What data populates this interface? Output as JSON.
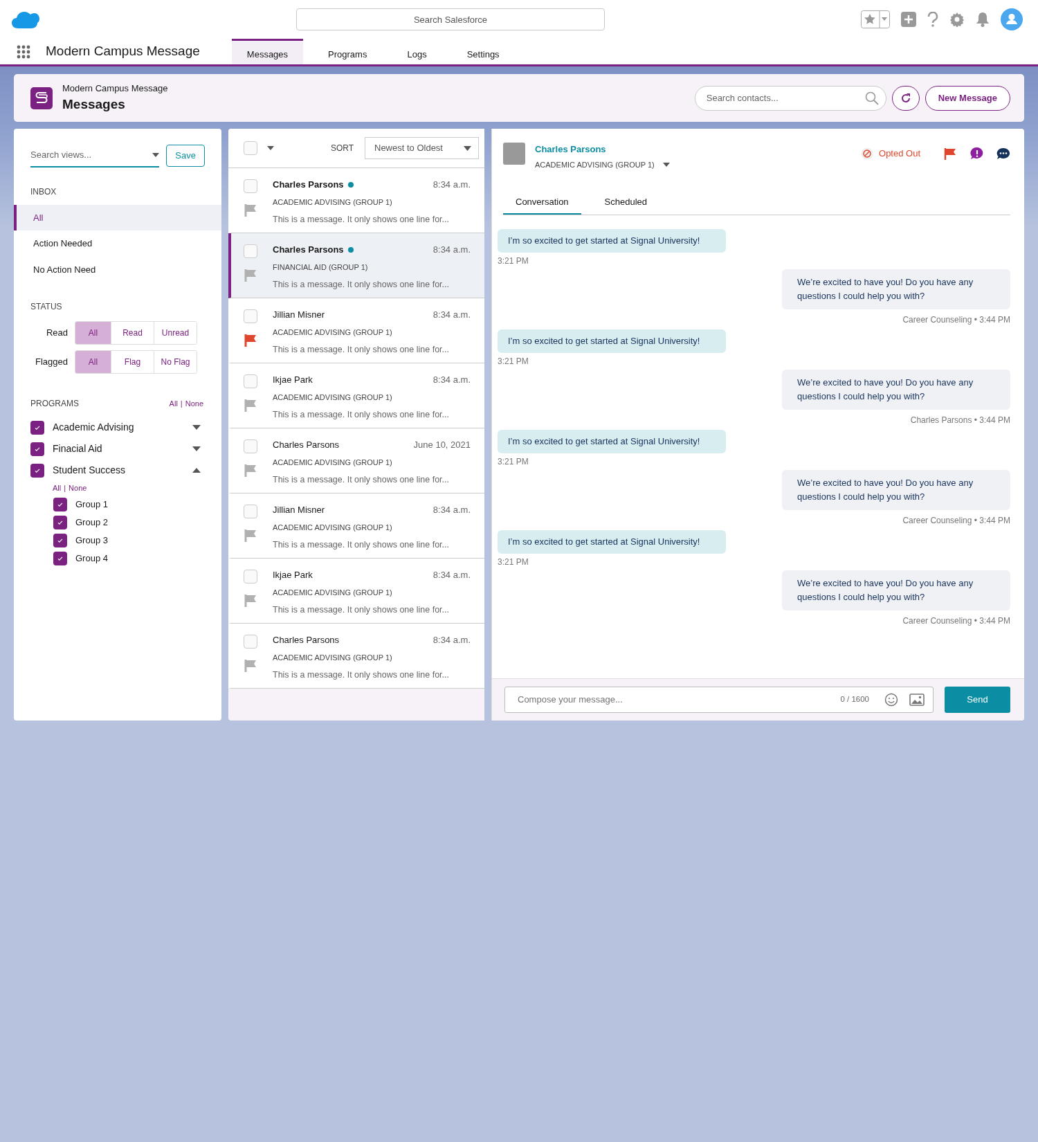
{
  "top_bar": {
    "search_placeholder": "Search Salesforce"
  },
  "app": {
    "name": "Modern Campus Message",
    "tabs": [
      {
        "label": "Messages",
        "selected": true
      },
      {
        "label": "Programs",
        "selected": false
      },
      {
        "label": "Logs",
        "selected": false
      },
      {
        "label": "Settings",
        "selected": false
      }
    ]
  },
  "page_header": {
    "app_name": "Modern Campus Message",
    "title": "Messages",
    "search_placeholder": "Search contacts...",
    "new_button": "New Message"
  },
  "sidebar": {
    "search_placeholder": "Search views...",
    "save_button": "Save",
    "inbox_heading": "INBOX",
    "inbox_items": [
      {
        "label": "All",
        "selected": true
      },
      {
        "label": "Action Needed",
        "selected": false
      },
      {
        "label": "No Action Need",
        "selected": false
      }
    ],
    "status_heading": "STATUS",
    "status_filters": [
      {
        "label": "Read",
        "options": [
          {
            "label": "All",
            "selected": true
          },
          {
            "label": "Read",
            "selected": false
          },
          {
            "label": "Unread",
            "selected": false
          }
        ]
      },
      {
        "label": "Flagged",
        "options": [
          {
            "label": "All",
            "selected": true
          },
          {
            "label": "Flag",
            "selected": false
          },
          {
            "label": "No Flag",
            "selected": false
          }
        ]
      }
    ],
    "programs_heading": "PROGRAMS",
    "programs_links": {
      "all": "All",
      "separator": "|",
      "none": "None"
    },
    "programs": [
      {
        "label": "Academic Advising",
        "checked": true,
        "expanded": false
      },
      {
        "label": "Finacial Aid",
        "checked": true,
        "expanded": false
      },
      {
        "label": "Student Success",
        "checked": true,
        "expanded": true,
        "links": {
          "all": "All",
          "separator": "|",
          "none": "None"
        },
        "children": [
          {
            "label": "Group 1",
            "checked": true
          },
          {
            "label": "Group 2",
            "checked": true
          },
          {
            "label": "Group 3",
            "checked": true
          },
          {
            "label": "Group 4",
            "checked": true
          }
        ]
      }
    ]
  },
  "message_list": {
    "select_all_checked": false,
    "sort_label": "SORT",
    "sort_value": "Newest to Oldest",
    "rows": [
      {
        "name": "Charles Parsons",
        "unread": true,
        "time": "8:34 a.m.",
        "program": "ACADEMIC ADVISING (GROUP 1)",
        "preview": "This is a message. It only shows one line for...",
        "checked": false,
        "flagged": false,
        "selected": false
      },
      {
        "name": "Charles Parsons",
        "unread": true,
        "time": "8:34 a.m.",
        "program": "FINANCIAL AID (GROUP 1)",
        "preview": "This is a message. It only shows one line for...",
        "checked": false,
        "flagged": false,
        "selected": true
      },
      {
        "name": "Jillian Misner",
        "unread": false,
        "time": "8:34 a.m.",
        "program": "ACADEMIC ADVISING (GROUP 1)",
        "preview": "This is a message. It only shows one line for...",
        "checked": false,
        "flagged": true,
        "selected": false
      },
      {
        "name": "Ikjae Park",
        "unread": false,
        "time": "8:34 a.m.",
        "program": "ACADEMIC ADVISING (GROUP 1)",
        "preview": "This is a message. It only shows one line for...",
        "checked": false,
        "flagged": false,
        "selected": false
      },
      {
        "name": "Charles Parsons",
        "unread": false,
        "time": "June 10, 2021",
        "program": "ACADEMIC ADVISING (GROUP 1)",
        "preview": "This is a message. It only shows one line for...",
        "checked": false,
        "flagged": false,
        "selected": false
      },
      {
        "name": "Jillian Misner",
        "unread": false,
        "time": "8:34 a.m.",
        "program": "ACADEMIC ADVISING (GROUP 1)",
        "preview": "This is a message. It only shows one line for...",
        "checked": false,
        "flagged": false,
        "selected": false
      },
      {
        "name": "Ikjae Park",
        "unread": false,
        "time": "8:34 a.m.",
        "program": "ACADEMIC ADVISING (GROUP 1)",
        "preview": "This is a message. It only shows one line for...",
        "checked": false,
        "flagged": false,
        "selected": false
      },
      {
        "name": "Charles Parsons",
        "unread": false,
        "time": "8:34 a.m.",
        "program": "ACADEMIC ADVISING (GROUP 1)",
        "preview": "This is a message. It only shows one line for...",
        "checked": false,
        "flagged": false,
        "selected": false
      }
    ]
  },
  "conversation": {
    "contact": {
      "name": "Charles Parsons",
      "program": "ACADEMIC ADVISING (GROUP 1)"
    },
    "status": "Opted Out",
    "tabs": [
      {
        "label": "Conversation",
        "selected": true
      },
      {
        "label": "Scheduled",
        "selected": false
      }
    ],
    "messages": [
      {
        "kind": "incoming",
        "text": "I’m so excited to get started at Signal University!",
        "meta": "3:21 PM"
      },
      {
        "kind": "outgoing",
        "text": "We’re excited to have you!  Do you have any questions I could help you with?",
        "meta": "Career Counseling • 3:44 PM"
      },
      {
        "kind": "incoming",
        "text": "I’m so excited to get started at Signal University!",
        "meta": "3:21 PM"
      },
      {
        "kind": "outgoing",
        "text": "We’re excited to have you!  Do you have any questions I could help you with?",
        "meta": "Charles Parsons • 3:44 PM"
      },
      {
        "kind": "incoming",
        "text": "I’m so excited to get started at Signal University!",
        "meta": "3:21 PM"
      },
      {
        "kind": "outgoing",
        "text": "We’re excited to have you!  Do you have any questions I could help you with?",
        "meta": "Career Counseling • 3:44 PM"
      },
      {
        "kind": "incoming",
        "text": "I’m so excited to get started at Signal University!",
        "meta": "3:21 PM"
      },
      {
        "kind": "outgoing",
        "text": "We’re excited to have you!  Do you have any questions I could help you with?",
        "meta": "Career Counseling • 3:44 PM"
      }
    ],
    "compose": {
      "placeholder": "Compose your message...",
      "counter": "0 / 1600",
      "send_button": "Send"
    }
  }
}
